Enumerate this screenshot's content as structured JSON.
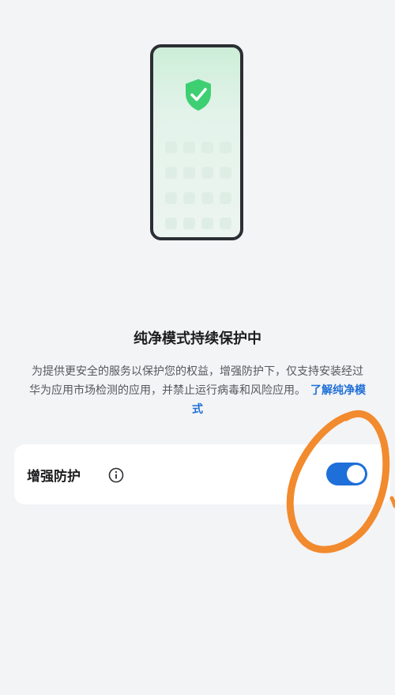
{
  "illustration": {
    "phone_icon": "phone-outline",
    "shield_icon": "shield-check-icon",
    "app_grid_rows": 4,
    "app_grid_cols": 4
  },
  "status": {
    "title": "纯净模式持续保护中",
    "description": "为提供更安全的服务以保护您的权益，增强防护下，仅支持安装经过华为应用市场检测的应用，并禁止运行病毒和风险应用。",
    "link_label": "了解纯净模式"
  },
  "setting": {
    "label": "增强防护",
    "info_icon": "info-icon",
    "toggle_on": true
  },
  "colors": {
    "accent": "#1E6FD9",
    "shield": "#3ECF73",
    "annotation": "#F28A2E"
  }
}
